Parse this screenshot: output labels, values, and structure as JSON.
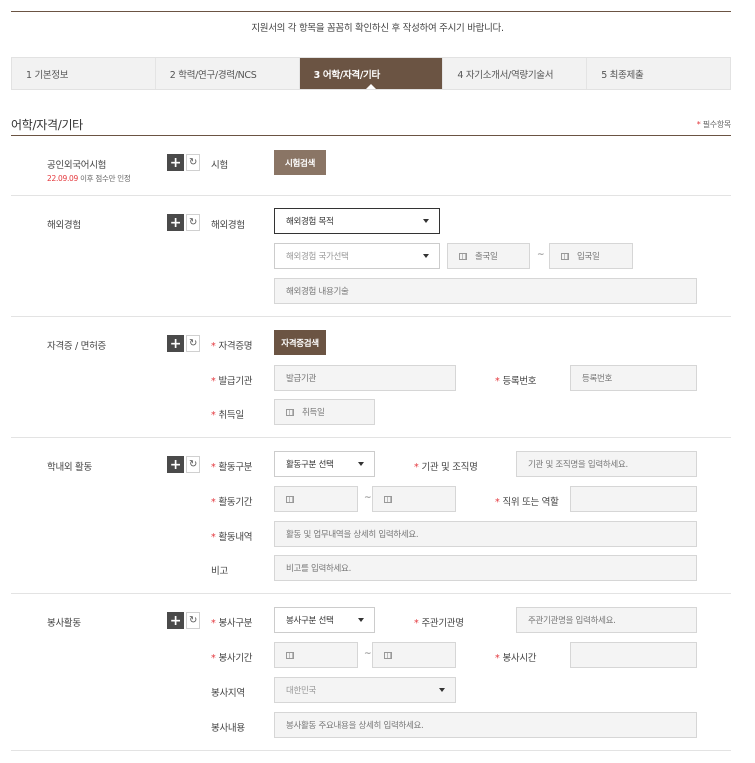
{
  "notice": "지원서의 각 항목을 꼼꼼히 확인하신 후 작성하여 주시기 바랍니다.",
  "steps": [
    {
      "label": "1  기본정보",
      "active": false
    },
    {
      "label": "2  학력/연구/경력/NCS",
      "active": false
    },
    {
      "label": "3  어학/자격/기타",
      "active": true
    },
    {
      "label": "4  자기소개서/역량기술서",
      "active": false
    },
    {
      "label": "5  최종제출",
      "active": false
    }
  ],
  "section_title": "어학/자격/기타",
  "required_note": "필수항목",
  "rows": {
    "lang": {
      "label": "공인외국어시험",
      "sub_red": "22.09.09",
      "sub_text": " 이후 점수만 인정",
      "field_label": "시험",
      "search_button": "시험검색"
    },
    "overseas": {
      "label": "해외경험",
      "field_label": "해외경험",
      "purpose_select": "해외경험 목적",
      "country_select": "해외경험 국가선택",
      "depart_placeholder": "출국일",
      "enter_placeholder": "입국일",
      "desc_placeholder": "해외경험 내용기술"
    },
    "cert": {
      "label": "자격증 / 면허증",
      "field_label": "자격증명",
      "search_button": "자격증검색",
      "issuer_label": "발급기관",
      "issuer_placeholder": "발급기관",
      "regno_label": "등록번호",
      "regno_placeholder": "등록번호",
      "date_label": "취득일",
      "date_placeholder": "취득일"
    },
    "campus": {
      "label": "학내외 활동",
      "type_label": "활동구분",
      "type_select": "활동구분 선택",
      "org_label": "기관 및 조직명",
      "org_placeholder": "기관 및 조직명을 입력하세요.",
      "period_label": "활동기간",
      "position_label": "직위 또는 역할",
      "detail_label": "활동내역",
      "detail_placeholder": "활동 및 업무내역을 상세히 입력하세요.",
      "note_label": "비고",
      "note_placeholder": "비고를 입력하세요."
    },
    "volunteer": {
      "label": "봉사활동",
      "type_label": "봉사구분",
      "type_select": "봉사구분 선택",
      "org_label": "주관기관명",
      "org_placeholder": "주관기관명을 입력하세요.",
      "period_label": "봉사기간",
      "hours_label": "봉사시간",
      "region_label": "봉사지역",
      "region_select": "대한민국",
      "content_label": "봉사내용",
      "content_placeholder": "봉사활동 주요내용을 상세히 입력하세요."
    }
  },
  "tilde": "~",
  "star": "*",
  "add_icon": "+",
  "reset_icon": "↻",
  "colors": {
    "brand": "#6b5443",
    "button": "#8a7565",
    "required": "#e4383d"
  }
}
